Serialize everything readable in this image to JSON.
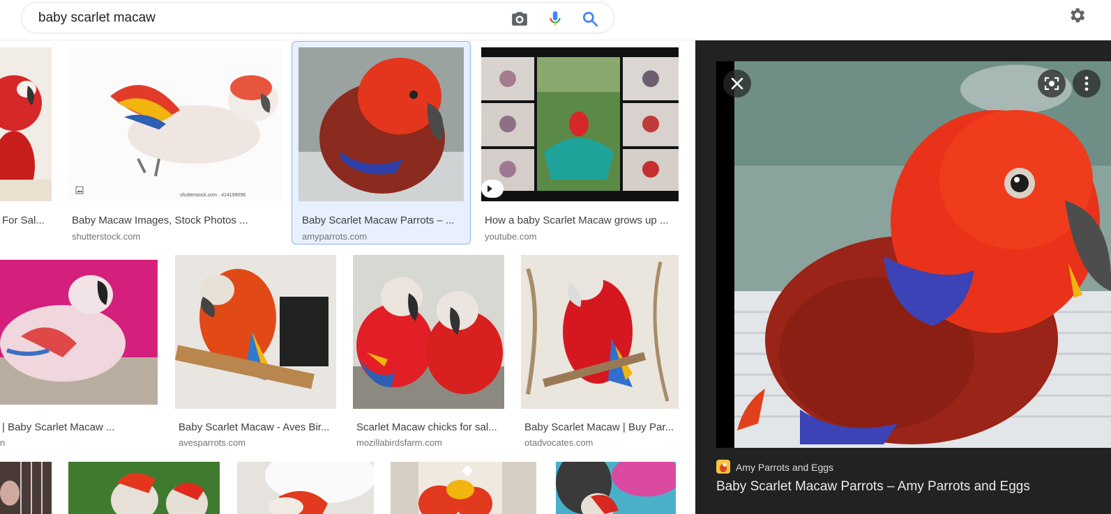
{
  "search": {
    "query": "baby scarlet macaw"
  },
  "icons": {
    "camera": "camera-icon",
    "mic": "mic-icon",
    "search": "search-icon",
    "settings": "gear-icon"
  },
  "results": [
    {
      "title": "For Sal...",
      "source": ""
    },
    {
      "title": "Baby Macaw Images, Stock Photos ...",
      "source": "shutterstock.com"
    },
    {
      "title": "Baby Scarlet Macaw Parrots – ...",
      "source": "amyparrots.com",
      "selected": true
    },
    {
      "title": "How a baby Scarlet Macaw grows up ...",
      "source": "youtube.com"
    },
    {
      "title": "| Baby Scarlet Macaw ...",
      "source": "n"
    },
    {
      "title": "Baby Scarlet Macaw - Aves Bir...",
      "source": "avesparrots.com"
    },
    {
      "title": "Scarlet Macaw chicks for sal...",
      "source": "mozillabirdsfarm.com"
    },
    {
      "title": "Baby Scarlet Macaw | Buy Par...",
      "source": "otadvocates.com"
    }
  ],
  "thumb_text": {
    "watermark": "shutterstock.com · 414199096"
  },
  "panel": {
    "site_name": "Amy Parrots and Eggs",
    "title": "Baby Scarlet Macaw Parrots – Amy Parrots and Eggs"
  },
  "colors": {
    "accent": "#1a73e8",
    "panel_bg": "#222222",
    "selected_bg": "#e8f0fe"
  }
}
